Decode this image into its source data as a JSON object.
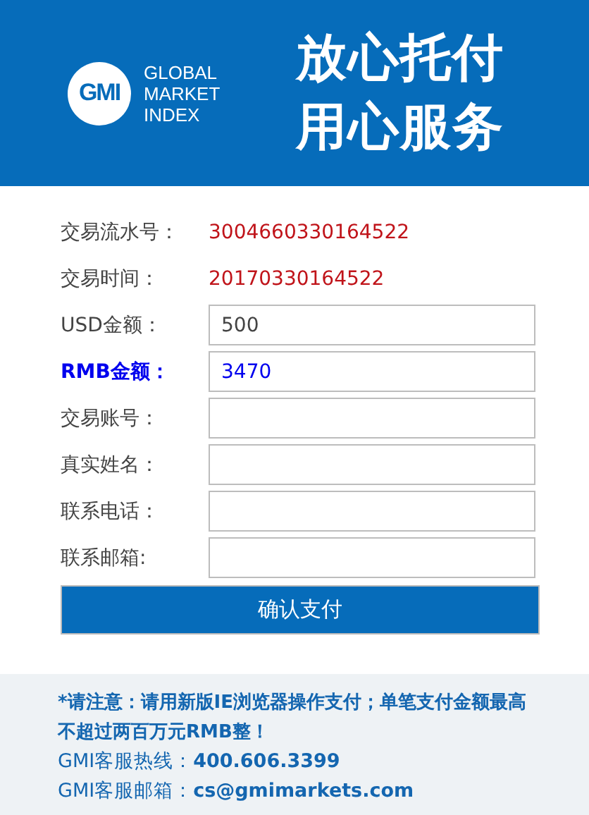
{
  "header": {
    "logo": {
      "mark": "GMI",
      "name_lines": [
        "GLOBAL",
        "MARKET",
        "INDEX"
      ]
    },
    "slogan_lines": [
      "放心托付",
      "用心服务"
    ]
  },
  "form": {
    "rows": [
      {
        "kind": "text",
        "label": "交易流水号：",
        "value": "3004660330164522",
        "highlight": false
      },
      {
        "kind": "text",
        "label": "交易时间：",
        "value": "20170330164522",
        "highlight": false
      },
      {
        "kind": "input",
        "label": "USD金额：",
        "value": "500",
        "highlight": false
      },
      {
        "kind": "input",
        "label": "RMB金额：",
        "value": "3470",
        "highlight": true
      },
      {
        "kind": "input",
        "label": "交易账号：",
        "highlight": false
      },
      {
        "kind": "input",
        "label": "真实姓名：",
        "highlight": false
      },
      {
        "kind": "input",
        "label": "联系电话：",
        "highlight": false
      },
      {
        "kind": "input",
        "label": "联系邮箱:",
        "highlight": false
      }
    ],
    "submit": "确认支付"
  },
  "footer": {
    "notice": "*请注意：请用新版IE浏览器操作支付；单笔支付金额最高不超过两百万元RMB整！",
    "contacts": [
      {
        "label": "GMI客服热线：",
        "value": "400.606.3399"
      },
      {
        "label": "GMI客服邮箱：",
        "value": "cs@gmimarkets.com"
      }
    ]
  }
}
